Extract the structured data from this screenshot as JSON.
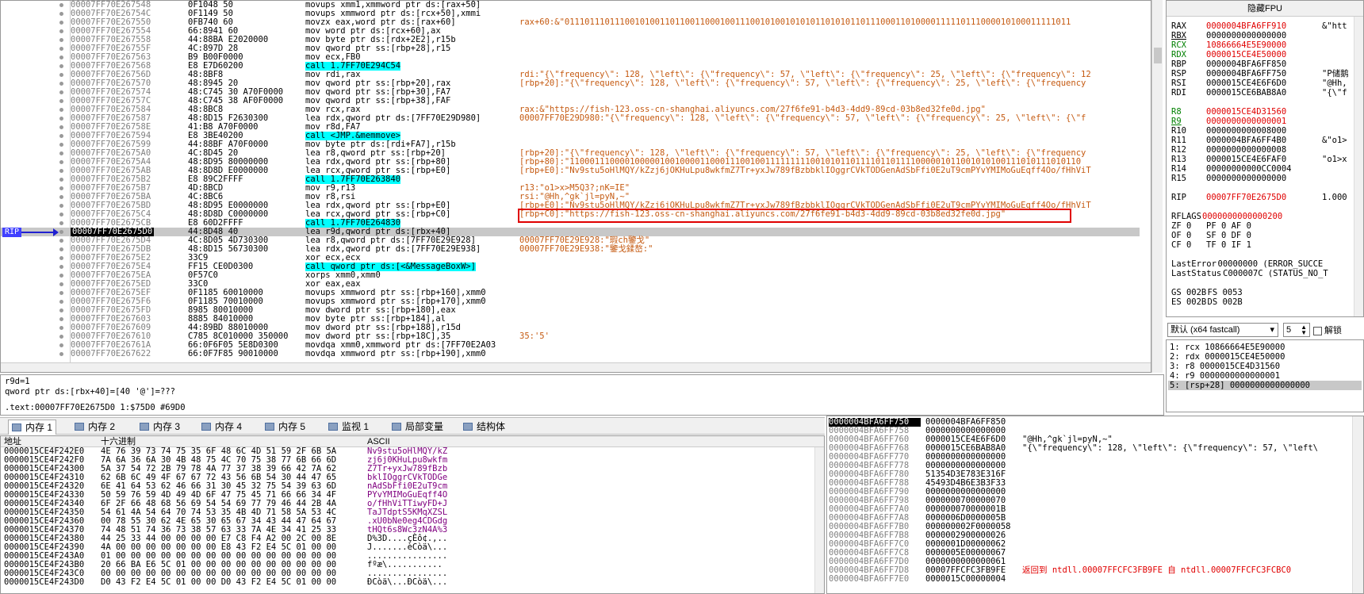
{
  "disasm": {
    "rows": [
      {
        "addr": "00007FF70E267548",
        "bytes": "0F1048 50",
        "asm": "movups xmm1,xmmword ptr ds:[rax+50]",
        "cmt": ""
      },
      {
        "addr": "00007FF70E26754C",
        "bytes": "0F1149 50",
        "asm": "movups xmmword ptr ds:[rcx+50],xmmi",
        "cmt": ""
      },
      {
        "addr": "00007FF70E267550",
        "bytes": "0FB740 60",
        "asm": "movzx eax,word ptr ds:[rax+60]",
        "cmt": "rax+60:&\"01110111011100101001101100110001001110010100101010110101011011100011010000111110111000010100011111011"
      },
      {
        "addr": "00007FF70E267554",
        "bytes": "66:8941 60",
        "asm": "mov word ptr ds:[rcx+60],ax",
        "cmt": ""
      },
      {
        "addr": "00007FF70E267558",
        "bytes": "44:88BA E2020000",
        "asm": "mov byte ptr ds:[rdx+2E2],r15b",
        "cmt": ""
      },
      {
        "addr": "00007FF70E26755F",
        "bytes": "4C:897D 28",
        "asm": "mov qword ptr ss:[rbp+28],r15",
        "cmt": ""
      },
      {
        "addr": "00007FF70E267563",
        "bytes": "B9 B00F0000",
        "asm": "mov ecx,FB0",
        "cmt": ""
      },
      {
        "addr": "00007FF70E267568",
        "bytes": "E8 E7D60200",
        "asm": "call 1.7FF70E294C54",
        "cmt": ""
      },
      {
        "addr": "00007FF70E26756D",
        "bytes": "48:8BF8",
        "asm": "mov rdi,rax",
        "cmt": "rdi:\"{\\\"frequency\\\": 128, \\\"left\\\": {\\\"frequency\\\": 57, \\\"left\\\": {\\\"frequency\\\": 25, \\\"left\\\": {\\\"frequency\\\": 12"
      },
      {
        "addr": "00007FF70E267570",
        "bytes": "48:8945 20",
        "asm": "mov qword ptr ss:[rbp+20],rax",
        "cmt": "[rbp+20]:\"{\\\"frequency\\\": 128, \\\"left\\\": {\\\"frequency\\\": 57, \\\"left\\\": {\\\"frequency\\\": 25, \\\"left\\\": {\\\"frequency"
      },
      {
        "addr": "00007FF70E267574",
        "bytes": "48:C745 30 A70F0000",
        "asm": "mov qword ptr ss:[rbp+30],FA7",
        "cmt": ""
      },
      {
        "addr": "00007FF70E26757C",
        "bytes": "48:C745 38 AF0F0000",
        "asm": "mov qword ptr ss:[rbp+38],FAF",
        "cmt": ""
      },
      {
        "addr": "00007FF70E267584",
        "bytes": "48:8BC8",
        "asm": "mov rcx,rax",
        "cmt": "rax:&\"https://fish-123.oss-cn-shanghai.aliyuncs.com/27f6fe91-b4d3-4dd9-89cd-03b8ed32fe0d.jpg\""
      },
      {
        "addr": "00007FF70E267587",
        "bytes": "48:8D15 F2630300",
        "asm": "lea rdx,qword ptr ds:[7FF70E29D980]",
        "cmt": "00007FF70E29D980:\"{\\\"frequency\\\": 128, \\\"left\\\": {\\\"frequency\\\": 57, \\\"left\\\": {\\\"frequency\\\": 25, \\\"left\\\": {\\\"f"
      },
      {
        "addr": "00007FF70E26758E",
        "bytes": "41:B8 A70F0000",
        "asm": "mov r8d,FA7",
        "cmt": ""
      },
      {
        "addr": "00007FF70E267594",
        "bytes": "E8 3BE40200",
        "asm": "call <JMP.&memmove>",
        "cmt": ""
      },
      {
        "addr": "00007FF70E267599",
        "bytes": "44:88BF A70F0000",
        "asm": "mov byte ptr ds:[rdi+FA7],r15b",
        "cmt": ""
      },
      {
        "addr": "00007FF70E2675A0",
        "bytes": "4C:8D45 20",
        "asm": "lea r8,qword ptr ss:[rbp+20]",
        "cmt": "[rbp+20]:\"{\\\"frequency\\\": 128, \\\"left\\\": {\\\"frequency\\\": 57, \\\"left\\\": {\\\"frequency\\\": 25, \\\"left\\\": {\\\"frequency"
      },
      {
        "addr": "00007FF70E2675A4",
        "bytes": "48:8D95 80000000",
        "asm": "lea rdx,qword ptr ss:[rbp+80]",
        "cmt": "[rbp+80]:\"110001110000100000100100001100011100100111111111001010110111101101111000001011001010100111010111010110"
      },
      {
        "addr": "00007FF70E2675AB",
        "bytes": "48:8D8D E0000000",
        "asm": "lea rcx,qword ptr ss:[rbp+E0]",
        "cmt": "[rbp+E0]:\"Nv9stu5oHlMQY/kZzj6jOKHuLpu8wkfmZ7Tr+yxJw789fBzbbklIOggrCVkTODGenAdSbFfi0E2uT9cmPYvYMIMoGuEqff4Oo/fHhViT"
      },
      {
        "addr": "00007FF70E2675B2",
        "bytes": "E8 89C2FFFF",
        "asm": "call 1.7FF70E263840",
        "cmt": ""
      },
      {
        "addr": "00007FF70E2675B7",
        "bytes": "4D:8BCD",
        "asm": "mov r9,r13",
        "cmt": "r13:\"o1>x>M5Q3?;nK=IE\""
      },
      {
        "addr": "00007FF70E2675BA",
        "bytes": "4C:8BC6",
        "asm": "mov r8,rsi",
        "cmt": "rsi:\"@Hh,^gk`jl=pyN,~\""
      },
      {
        "addr": "00007FF70E2675BD",
        "bytes": "48:8D95 E0000000",
        "asm": "lea rdx,qword ptr ss:[rbp+E0]",
        "cmt": "[rbp+E0]:\"Nv9stu5oHlMQY/kZzj6jOKHuLpu8wkfmZ7Tr+yxJw789fBzbbklIOggrCVkTODGenAdSbFfi0E2uT9cmPYvYMIMoGuEqff4Oo/fHhViT"
      },
      {
        "addr": "00007FF70E2675C4",
        "bytes": "48:8D8D C0000000",
        "asm": "lea rcx,qword ptr ss:[rbp+C0]",
        "cmt": "[rbp+C0]:\"https://fish-123.oss-cn-shanghai.aliyuncs.com/27f6fe91-b4d3-4dd9-89cd-03b8ed32fe0d.jpg\""
      },
      {
        "addr": "00007FF70E2675CB",
        "bytes": "E8 60D2FFFF",
        "asm": "call 1.7FF70E264830",
        "cmt": ""
      },
      {
        "addr": "00007FF70E2675D0",
        "bytes": "44:8D48 40",
        "asm": "lea r9d,qword ptr ds:[rbx+40]",
        "cmt": ""
      },
      {
        "addr": "00007FF70E2675D4",
        "bytes": "4C:8D05 4D730300",
        "asm": "lea r8,qword ptr ds:[7FF70E29E928]",
        "cmt": "00007FF70E29E928:\"瑕ch鑒戈\""
      },
      {
        "addr": "00007FF70E2675DB",
        "bytes": "48:8D15 56730300",
        "asm": "lea rdx,qword ptr ds:[7FF70E29E938]",
        "cmt": "00007FF70E29E938:\"鑒戈鍒嶅:\""
      },
      {
        "addr": "00007FF70E2675E2",
        "bytes": "33C9",
        "asm": "xor ecx,ecx",
        "cmt": ""
      },
      {
        "addr": "00007FF70E2675E4",
        "bytes": "FF15 CE0D0300",
        "asm": "call qword ptr ds:[<&MessageBoxW>]",
        "cmt": ""
      },
      {
        "addr": "00007FF70E2675EA",
        "bytes": "0F57C0",
        "asm": "xorps xmm0,xmm0",
        "cmt": ""
      },
      {
        "addr": "00007FF70E2675ED",
        "bytes": "33C0",
        "asm": "xor eax,eax",
        "cmt": ""
      },
      {
        "addr": "00007FF70E2675EF",
        "bytes": "0F1185 60010000",
        "asm": "movups xmmword ptr ss:[rbp+160],xmm0",
        "cmt": ""
      },
      {
        "addr": "00007FF70E2675F6",
        "bytes": "0F1185 70010000",
        "asm": "movups xmmword ptr ss:[rbp+170],xmm0",
        "cmt": ""
      },
      {
        "addr": "00007FF70E2675FD",
        "bytes": "8985 80010000",
        "asm": "mov dword ptr ss:[rbp+180],eax",
        "cmt": ""
      },
      {
        "addr": "00007FF70E267603",
        "bytes": "8885 84010000",
        "asm": "mov byte ptr ss:[rbp+184],al",
        "cmt": ""
      },
      {
        "addr": "00007FF70E267609",
        "bytes": "44:89BD 88010000",
        "asm": "mov dword ptr ss:[rbp+188],r15d",
        "cmt": ""
      },
      {
        "addr": "00007FF70E267610",
        "bytes": "C785 8C010000 350000",
        "asm": "mov dword ptr ss:[rbp+18C],35",
        "cmt": "35:'5'"
      },
      {
        "addr": "00007FF70E26761A",
        "bytes": "66:0F6F05 5E8D0300",
        "asm": "movdqa xmm0,xmmword ptr ds:[7FF70E2A03",
        "cmt": ""
      },
      {
        "addr": "00007FF70E267622",
        "bytes": "66:0F7F85 90010000",
        "asm": "movdqa xmmword ptr ss:[rbp+190],xmm0",
        "cmt": ""
      }
    ],
    "rip_label": "RIP",
    "rip_index": 26,
    "highlight_index": 24
  },
  "info": {
    "line1": "r9d=1",
    "line2": "qword ptr ds:[rbx+40]=[40 '@']=???",
    "line3": ".text:00007FF70E2675D0 1:$75D0 #69D0"
  },
  "regs": {
    "title": "隐藏FPU",
    "rows": [
      {
        "n": "RAX",
        "v": "0000004BFA6FF910",
        "c": "&\"htt",
        "cls": "red"
      },
      {
        "n": "RBX",
        "v": "0000000000000000",
        "c": "",
        "cls": "",
        "ul": true
      },
      {
        "n": "RCX",
        "v": "10866664E5E90000",
        "c": "",
        "cls": "green"
      },
      {
        "n": "RDX",
        "v": "0000015CE4E50000",
        "c": "",
        "cls": "green"
      },
      {
        "n": "RBP",
        "v": "0000004BFA6FF850",
        "c": "",
        "cls": ""
      },
      {
        "n": "RSP",
        "v": "0000004BFA6FF750",
        "c": "\"P储鹅",
        "cls": ""
      },
      {
        "n": "RSI",
        "v": "0000015CE4E6F6D0",
        "c": "\"@Hh,",
        "cls": ""
      },
      {
        "n": "RDI",
        "v": "0000015CE6BAB8A0",
        "c": "\"{\\\"f",
        "cls": ""
      },
      {
        "n": "",
        "v": "",
        "c": "",
        "cls": ""
      },
      {
        "n": "R8",
        "v": "0000015CE4D31560",
        "c": "",
        "cls": "green"
      },
      {
        "n": "R9",
        "v": "0000000000000001",
        "c": "",
        "cls": "green",
        "ul": true
      },
      {
        "n": "R10",
        "v": "0000000000008000",
        "c": "",
        "cls": ""
      },
      {
        "n": "R11",
        "v": "0000004BFA6FF4B0",
        "c": "&\"o1>",
        "cls": ""
      },
      {
        "n": "R12",
        "v": "0000000000000008",
        "c": "",
        "cls": ""
      },
      {
        "n": "R13",
        "v": "0000015CE4E6FAF0",
        "c": "\"o1>x",
        "cls": ""
      },
      {
        "n": "R14",
        "v": "00000000000CC0004",
        "c": "",
        "cls": ""
      },
      {
        "n": "R15",
        "v": "0000000000000000",
        "c": "",
        "cls": ""
      },
      {
        "n": "",
        "v": "",
        "c": "",
        "cls": ""
      },
      {
        "n": "RIP",
        "v": "00007FF70E2675D0",
        "c": "1.000",
        "cls": "red"
      },
      {
        "n": "",
        "v": "",
        "c": "",
        "cls": ""
      },
      {
        "n": "RFLAGS",
        "v": "  0000000000000200",
        "c": "",
        "cls": "red"
      },
      {
        "n": "ZF 0",
        "v": "  PF 0    AF 0",
        "c": "",
        "cls": ""
      },
      {
        "n": "OF 0",
        "v": "  SF 0    DF 0",
        "c": "",
        "cls": ""
      },
      {
        "n": "CF 0",
        "v": "  TF 0    IF 1",
        "c": "",
        "cls": ""
      },
      {
        "n": "",
        "v": "",
        "c": "",
        "cls": ""
      },
      {
        "n": "LastError",
        "v": "      00000000 (ERROR_SUCCE",
        "c": "",
        "cls": ""
      },
      {
        "n": "LastStatus",
        "v": "     C000007C (STATUS_NO_T",
        "c": "",
        "cls": ""
      },
      {
        "n": "",
        "v": "",
        "c": "",
        "cls": ""
      },
      {
        "n": "GS 002B",
        "v": "  FS 0053",
        "c": "",
        "cls": ""
      },
      {
        "n": "ES 002B",
        "v": "  DS 002B",
        "c": "",
        "cls": ""
      }
    ]
  },
  "callconv": {
    "selected": "默认 (x64 fastcall)",
    "count": "5",
    "unlock_label": "解锁",
    "args": [
      "1: rcx 10866664E5E90000",
      "2: rdx 0000015CE4E50000",
      "3: r8 0000015CE4D31560",
      "4: r9 0000000000000001",
      "5: [rsp+28] 0000000000000000"
    ]
  },
  "tabs": [
    {
      "label": "内存 1",
      "active": true
    },
    {
      "label": "内存 2",
      "active": false
    },
    {
      "label": "内存 3",
      "active": false
    },
    {
      "label": "内存 4",
      "active": false
    },
    {
      "label": "内存 5",
      "active": false
    },
    {
      "label": "监视 1",
      "active": false
    },
    {
      "label": "局部变量",
      "active": false
    },
    {
      "label": "结构体",
      "active": false
    }
  ],
  "dump": {
    "col_addr": "地址",
    "col_hex": "十六进制",
    "col_ascii": "ASCII",
    "rows": [
      {
        "a": "0000015CE4F242E0",
        "h": "4E 76 39 73 74 75 35 6F 48 6C 4D 51 59 2F 6B 5A",
        "c": "Nv9stu5oHlMQY/kZ"
      },
      {
        "a": "0000015CE4F242F0",
        "h": "7A 6A 36 6A 30 4B 48 75 4C 70 75 38 77 6B 66 6D",
        "c": "zj6j0KHuLpu8wkfm"
      },
      {
        "a": "0000015CE4F24300",
        "h": "5A 37 54 72 2B 79 78 4A 77 37 38 39 66 42 7A 62",
        "c": "Z7Tr+yxJw789fBzb"
      },
      {
        "a": "0000015CE4F24310",
        "h": "62 6B 6C 49 4F 67 67 72 43 56 6B 54 30 44 47 65",
        "c": "bklIOggrCVkTODGe"
      },
      {
        "a": "0000015CE4F24320",
        "h": "6E 41 64 53 62 46 66 31 30 45 32 75 54 39 63 6D",
        "c": "nAdSbFfi0E2uT9cm"
      },
      {
        "a": "0000015CE4F24330",
        "h": "50 59 76 59 4D 49 4D 6F 47 75 45 71 66 66 34 4F",
        "c": "PYvYMIMoGuEqff4O"
      },
      {
        "a": "0000015CE4F24340",
        "h": "6F 2F 66 48 68 56 69 54 54 69 77 79 46 44 2B 4A",
        "c": "o/fHhViTTiwyFD+J"
      },
      {
        "a": "0000015CE4F24350",
        "h": "54 61 4A 54 64 70 74 53 35 4B 4D 71 58 5A 53 4C",
        "c": "TaJTdptS5KMqXZSL"
      },
      {
        "a": "0000015CE4F24360",
        "h": "00 78 55 30 62 4E 65 30 65 67 34 43 44 47 64 67",
        "c": ".xU0bNe0eg4CDGdg"
      },
      {
        "a": "0000015CE4F24370",
        "h": "74 48 51 74 36 73 38 57 63 33 7A 4E 34 41 25 33",
        "c": "tHQt6s8Wc3zN4A%3"
      },
      {
        "a": "0000015CE4F24380",
        "h": "44 25 33 44 00 00 00 00 E7 C8 F4 A2 00 2C 00 8E",
        "c": "D%3D....çÈô¢.,.."
      },
      {
        "a": "0000015CE4F24390",
        "h": "4A 00 00 00 00 00 00 00 E8 43 F2 E4 5C 01 00 00",
        "c": "J.......èCòä\\..."
      },
      {
        "a": "0000015CE4F243A0",
        "h": "01 00 00 00 00 00 00 00 00 00 00 00 00 00 00 00",
        "c": "................"
      },
      {
        "a": "0000015CE4F243B0",
        "h": "20 66 BA E6 5C 01 00 00 00 00 00 00 00 00 00 00",
        "c": " fºæ\\..........."
      },
      {
        "a": "0000015CE4F243C0",
        "h": "00 00 00 00 00 00 00 00 00 00 00 00 00 00 00 00",
        "c": "................"
      },
      {
        "a": "0000015CE4F243D0",
        "h": "D0 43 F2 E4 5C 01 00 00 D0 43 F2 E4 5C 01 00 00",
        "c": "ÐCòä\\...ÐCòä\\..."
      }
    ]
  },
  "stack": {
    "rows": [
      {
        "a": "0000004BFA6FF750",
        "v": "0000004BFA6FF850",
        "c": "",
        "red": false
      },
      {
        "a": "0000004BFA6FF758",
        "v": "0000000000000000",
        "c": "",
        "red": false
      },
      {
        "a": "0000004BFA6FF760",
        "v": "0000015CE4E6F6D0",
        "c": "\"@Hh,^gk`jl=pyN,~\"",
        "red": false
      },
      {
        "a": "0000004BFA6FF768",
        "v": "0000015CE6BAB8A0",
        "c": "\"{\\\"frequency\\\": 128, \\\"left\\\": {\\\"frequency\\\": 57, \\\"left\\",
        "red": false
      },
      {
        "a": "0000004BFA6FF770",
        "v": "0000000000000000",
        "c": "",
        "red": false
      },
      {
        "a": "0000004BFA6FF778",
        "v": "0000000000000000",
        "c": "",
        "red": false
      },
      {
        "a": "0000004BFA6FF780",
        "v": "51354D3E783E316F",
        "c": "",
        "red": false
      },
      {
        "a": "0000004BFA6FF788",
        "v": "45493D4B6E3B3F33",
        "c": "",
        "red": false
      },
      {
        "a": "0000004BFA6FF790",
        "v": "0000000000000000",
        "c": "",
        "red": false
      },
      {
        "a": "0000004BFA6FF798",
        "v": "0000000700000070",
        "c": "",
        "red": false
      },
      {
        "a": "0000004BFA6FF7A0",
        "v": "000000070000001B",
        "c": "",
        "red": false
      },
      {
        "a": "0000004BFA6FF7A8",
        "v": "0000006D0000005B",
        "c": "",
        "red": false
      },
      {
        "a": "0000004BFA6FF7B0",
        "v": "000000002F0000058",
        "c": "",
        "red": false
      },
      {
        "a": "0000004BFA6FF7B8",
        "v": "0000002900000026",
        "c": "",
        "red": false
      },
      {
        "a": "0000004BFA6FF7C0",
        "v": "0000001D00000062",
        "c": "",
        "red": false
      },
      {
        "a": "0000004BFA6FF7C8",
        "v": "0000005E00000067",
        "c": "",
        "red": false
      },
      {
        "a": "0000004BFA6FF7D0",
        "v": "0000000000000061",
        "c": "",
        "red": false
      },
      {
        "a": "0000004BFA6FF7D8",
        "v": "00007FFCFC3FB9FE",
        "c": "返回到 ntdll.00007FFCFC3FB9FE 自 ntdll.00007FFCFC3FCBC0",
        "red": true
      },
      {
        "a": "0000004BFA6FF7E0",
        "v": "0000015C00000004",
        "c": "",
        "red": false
      }
    ]
  }
}
